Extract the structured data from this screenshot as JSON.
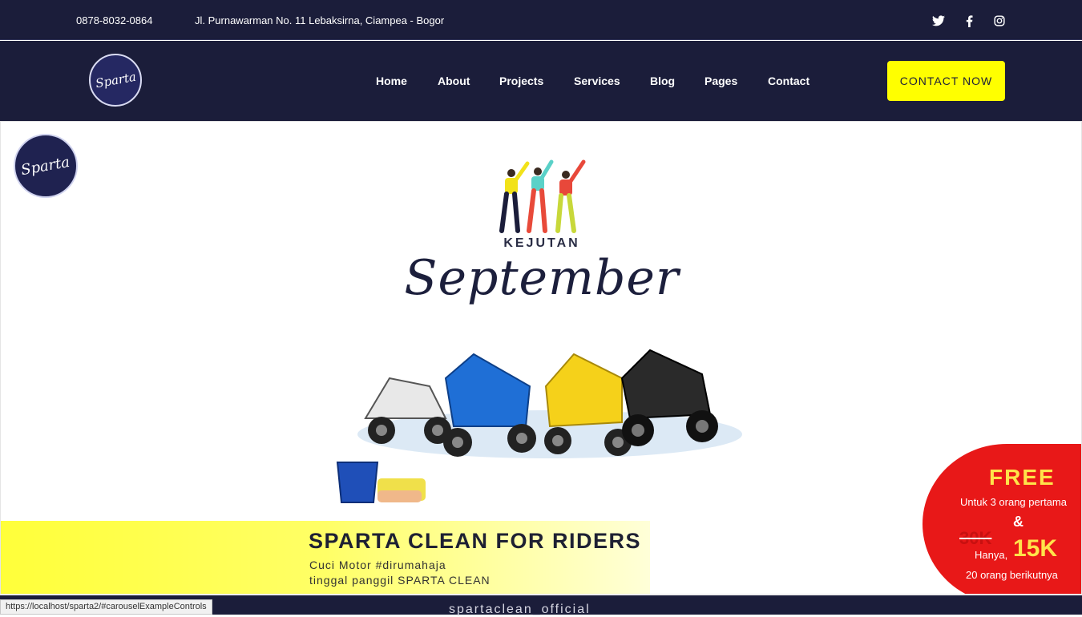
{
  "topbar": {
    "phone": "0878-8032-0864",
    "address": "Jl. Purnawarman No. 11 Lebaksirna, Ciampea - Bogor",
    "social": [
      {
        "icon": "twitter-icon"
      },
      {
        "icon": "facebook-icon"
      },
      {
        "icon": "instagram-icon"
      }
    ]
  },
  "navbar": {
    "logo_text": "Sparta",
    "links": [
      "Home",
      "About",
      "Projects",
      "Services",
      "Blog",
      "Pages",
      "Contact"
    ],
    "cta_label": "CONTACT NOW"
  },
  "hero": {
    "logo_text": "Sparta",
    "kejutan": "KEJUTAN",
    "september": "September",
    "band_title": "SPARTA CLEAN FOR RIDERS",
    "band_line1": "Cuci Motor #dirumahaja",
    "band_line2": "tinggal panggil SPARTA CLEAN",
    "promo": {
      "free": "FREE",
      "line1": "Untuk 3 orang pertama",
      "amp": "&",
      "old_price": "30K",
      "hanya": "Hanya,",
      "new_price": "15K",
      "line2": "20 orang berikutnya"
    }
  },
  "footer": {
    "text": "spartaclean_official"
  },
  "statusbar": {
    "url": "https://localhost/sparta2/#carouselExampleControls"
  },
  "colors": {
    "navy": "#1b1d3a",
    "accent_yellow": "#ffff00",
    "promo_red": "#e81818"
  }
}
